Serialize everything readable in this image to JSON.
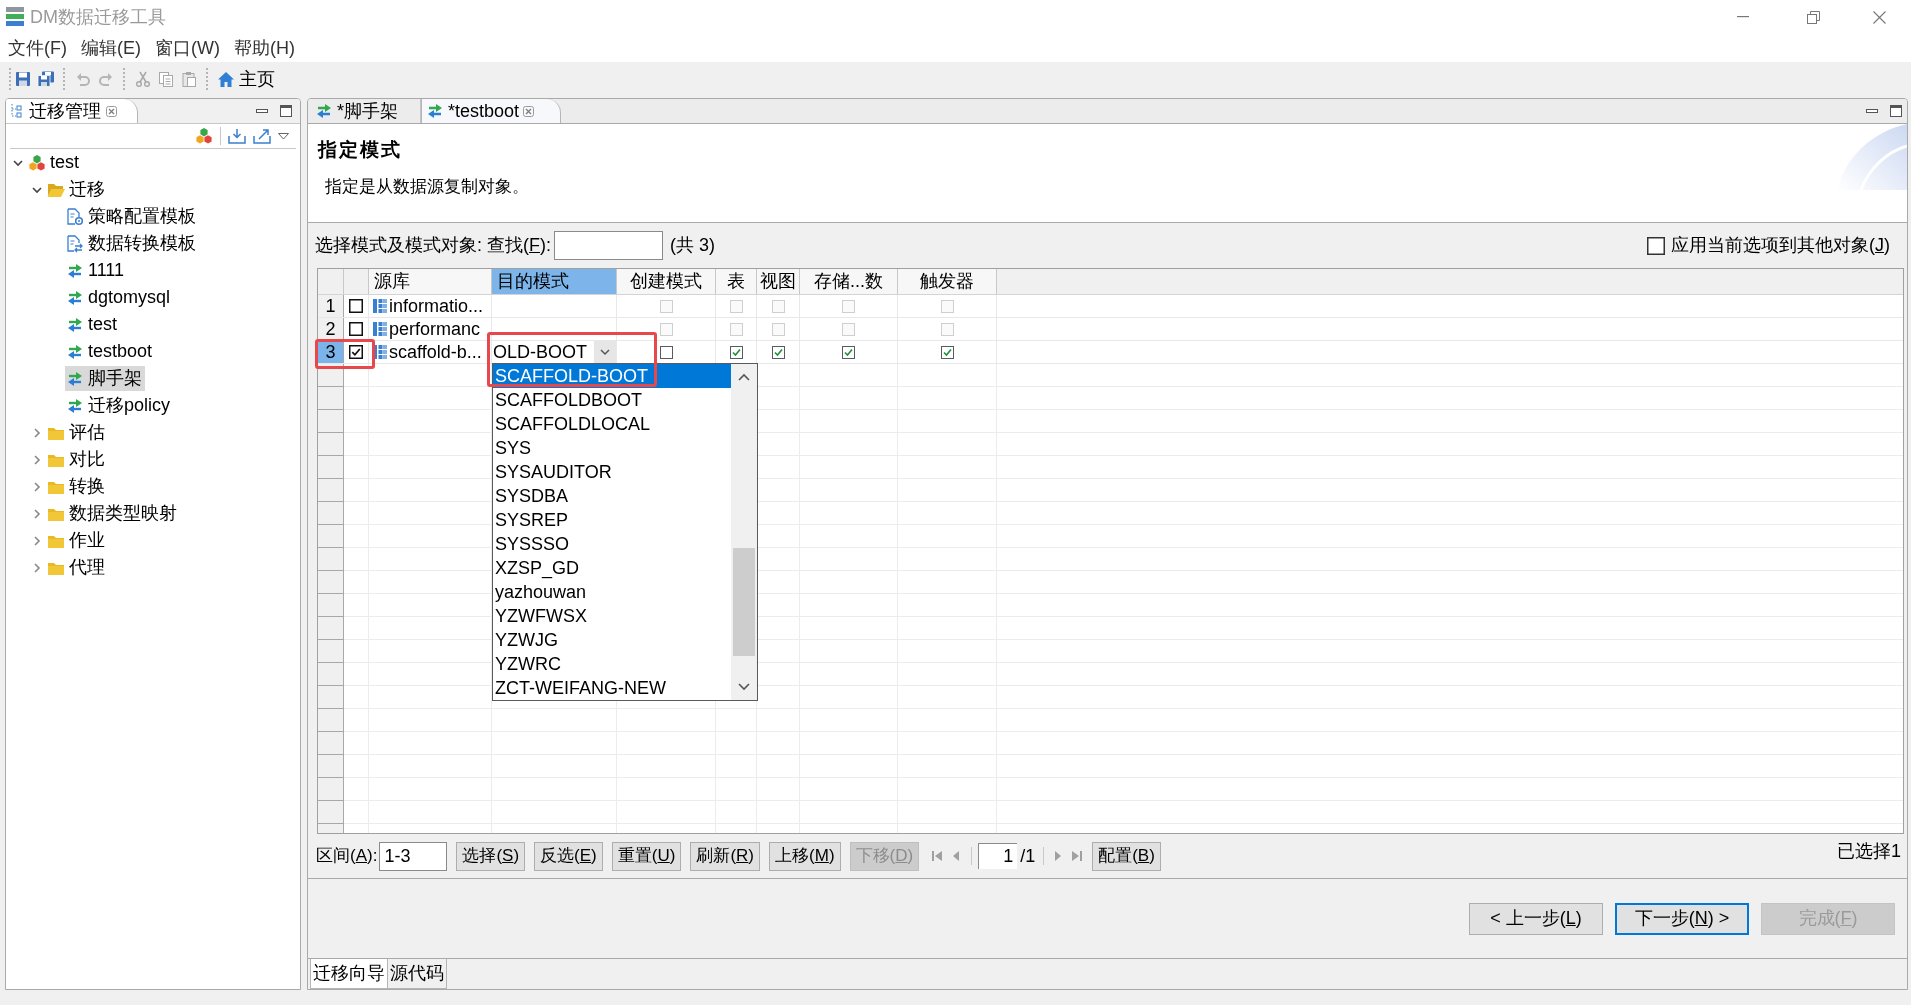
{
  "window": {
    "title": "DM数据迁移工具"
  },
  "menu": [
    "文件(F)",
    "编辑(E)",
    "窗口(W)",
    "帮助(H)"
  ],
  "toolbar": [
    {
      "kind": "save",
      "disabled": false
    },
    {
      "kind": "saveall",
      "disabled": false
    },
    {
      "kind": "separator"
    },
    {
      "kind": "undo",
      "disabled": true
    },
    {
      "kind": "redo",
      "disabled": true
    },
    {
      "kind": "separator"
    },
    {
      "kind": "cut",
      "disabled": true
    },
    {
      "kind": "copy",
      "disabled": true
    },
    {
      "kind": "paste",
      "disabled": true
    },
    {
      "kind": "separator"
    },
    {
      "kind": "home",
      "label": "主页"
    }
  ],
  "navigator": {
    "title": "迁移管理",
    "tree": [
      {
        "label": "test",
        "kind": "project",
        "expanded": true,
        "selected": false,
        "children": [
          {
            "label": "迁移",
            "kind": "folder",
            "expanded": true,
            "selected": false,
            "children": [
              {
                "label": "策略配置模板",
                "kind": "policy",
                "selected": false
              },
              {
                "label": "数据转换模板",
                "kind": "transform",
                "selected": false
              },
              {
                "label": "1111",
                "kind": "migration",
                "selected": false
              },
              {
                "label": "dgtomysql",
                "kind": "migration",
                "selected": false
              },
              {
                "label": "test",
                "kind": "migration",
                "selected": false
              },
              {
                "label": "testboot",
                "kind": "migration",
                "selected": false
              },
              {
                "label": "脚手架",
                "kind": "migration",
                "selected": true
              },
              {
                "label": "迁移policy",
                "kind": "migration",
                "selected": false
              }
            ]
          },
          {
            "label": "评估",
            "kind": "folder",
            "expanded": false,
            "selected": false
          },
          {
            "label": "对比",
            "kind": "folder",
            "expanded": false,
            "selected": false
          },
          {
            "label": "转换",
            "kind": "folder",
            "expanded": false,
            "selected": false
          },
          {
            "label": "数据类型映射",
            "kind": "folder",
            "expanded": false,
            "selected": false
          },
          {
            "label": "作业",
            "kind": "folder",
            "expanded": false,
            "selected": false
          },
          {
            "label": "代理",
            "kind": "folder",
            "expanded": false,
            "selected": false
          }
        ]
      }
    ]
  },
  "editor": {
    "tabs": [
      {
        "label": "*脚手架",
        "selected": false
      },
      {
        "label": "*testboot",
        "selected": true
      }
    ],
    "page": {
      "title": "指定模式",
      "description": "指定是从数据源复制对象。"
    },
    "filter": {
      "label": "选择模式及模式对象:",
      "find_label": "查找(F):",
      "count": "(共 3)"
    },
    "apply_to_others": {
      "label": "应用当前选项到其他对象(J)",
      "checked": false
    },
    "table": {
      "columns": [
        {
          "label": "源库",
          "selected": false
        },
        {
          "label": "目的模式",
          "selected": true
        },
        {
          "label": "创建模式",
          "selected": false
        },
        {
          "label": "表",
          "selected": false
        },
        {
          "label": "视图",
          "selected": false
        },
        {
          "label": "存储...数",
          "selected": false
        },
        {
          "label": "触发器",
          "selected": false
        }
      ],
      "rows": [
        {
          "number": "1",
          "selected": false,
          "checked": false,
          "highlighted": false,
          "source": "informatio...",
          "options": [
            {
              "checked": false,
              "disabled": true
            },
            {
              "checked": false,
              "disabled": true
            },
            {
              "checked": false,
              "disabled": true
            },
            {
              "checked": false,
              "disabled": true
            },
            {
              "checked": false,
              "disabled": true
            }
          ]
        },
        {
          "number": "2",
          "selected": false,
          "checked": false,
          "highlighted": false,
          "source": "performanc",
          "options": [
            {
              "checked": false,
              "disabled": true
            },
            {
              "checked": false,
              "disabled": true
            },
            {
              "checked": false,
              "disabled": true
            },
            {
              "checked": false,
              "disabled": true
            },
            {
              "checked": false,
              "disabled": true
            }
          ]
        },
        {
          "number": "3",
          "selected": true,
          "checked": true,
          "highlighted": true,
          "source": "scaffold-b...",
          "target_editor": {
            "value": "OLD-BOOT",
            "highlighted": true,
            "items": [
              {
                "label": "SCAFFOLD-BOOT",
                "selected": true
              },
              {
                "label": "SCAFFOLDBOOT",
                "selected": false
              },
              {
                "label": "SCAFFOLDLOCAL",
                "selected": false
              },
              {
                "label": "SYS",
                "selected": false
              },
              {
                "label": "SYSAUDITOR",
                "selected": false
              },
              {
                "label": "SYSDBA",
                "selected": false
              },
              {
                "label": "SYSREP",
                "selected": false
              },
              {
                "label": "SYSSSO",
                "selected": false
              },
              {
                "label": "XZSP_GD",
                "selected": false
              },
              {
                "label": "yazhouwan",
                "selected": false
              },
              {
                "label": "YZWFWSX",
                "selected": false
              },
              {
                "label": "YZWJG",
                "selected": false
              },
              {
                "label": "YZWRC",
                "selected": false
              },
              {
                "label": "ZCT-WEIFANG-NEW",
                "selected": false
              }
            ]
          },
          "options": [
            {
              "checked": false,
              "disabled": false
            },
            {
              "checked": true,
              "disabled": false
            },
            {
              "checked": true,
              "disabled": false
            },
            {
              "checked": true,
              "disabled": false
            },
            {
              "checked": true,
              "disabled": false
            }
          ]
        }
      ]
    },
    "range": {
      "label": "区间(A):",
      "value": "1-3"
    },
    "actions": [
      {
        "label": "选择(S)",
        "disabled": false
      },
      {
        "label": "反选(E)",
        "disabled": false
      },
      {
        "label": "重置(U)",
        "disabled": false
      },
      {
        "label": "刷新(R)",
        "disabled": false
      },
      {
        "label": "上移(M)",
        "disabled": false
      },
      {
        "label": "下移(D)",
        "disabled": true
      }
    ],
    "pager": {
      "page": "1",
      "total": "/1"
    },
    "config_button": "配置(B)",
    "selection_status": "已选择1",
    "wizard_buttons": [
      {
        "label": "< 上一步(L)",
        "disabled": false,
        "focused": false
      },
      {
        "label": "下一步(N) >",
        "disabled": false,
        "focused": true
      },
      {
        "label": "完成(F)",
        "disabled": true,
        "focused": false
      }
    ],
    "bottom_tabs": [
      {
        "label": "迁移向导",
        "selected": true
      },
      {
        "label": "源代码",
        "selected": false
      }
    ]
  }
}
